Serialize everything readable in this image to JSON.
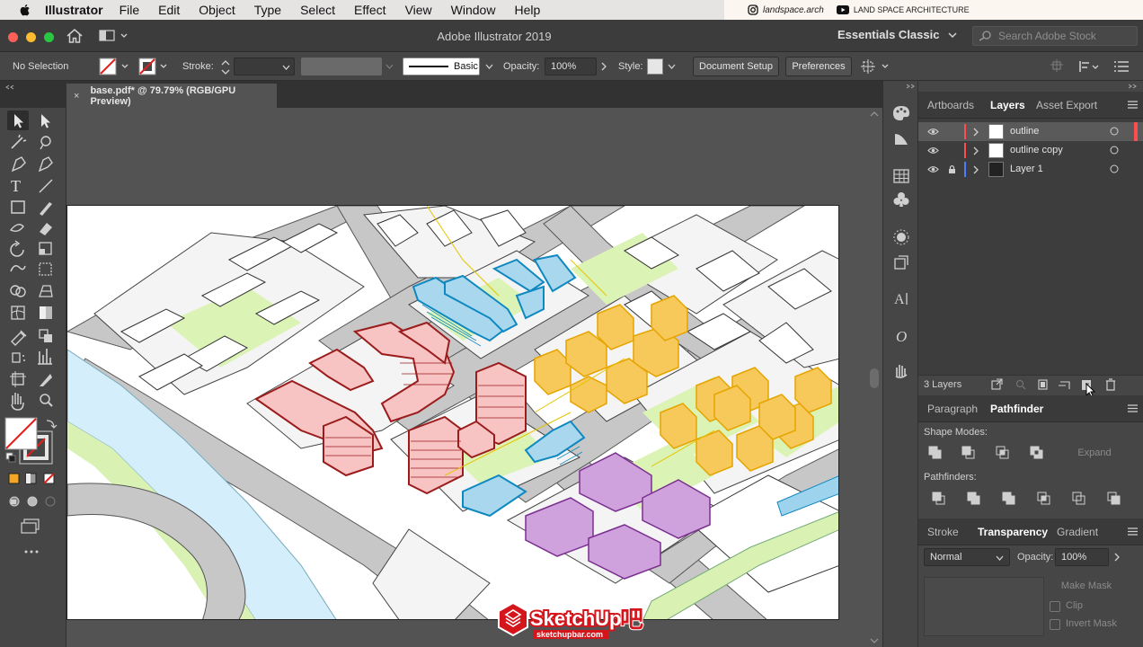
{
  "menubar": {
    "app": "Illustrator",
    "items": [
      "File",
      "Edit",
      "Object",
      "Type",
      "Select",
      "Effect",
      "View",
      "Window",
      "Help"
    ],
    "instagram": "landspace.arch",
    "youtube": "LAND SPACE ARCHITECTURE"
  },
  "appbar": {
    "title": "Adobe Illustrator 2019",
    "workspace": "Essentials Classic",
    "search_placeholder": "Search Adobe Stock"
  },
  "control": {
    "selection": "No Selection",
    "stroke_label": "Stroke:",
    "brush": "Basic",
    "opacity_label": "Opacity:",
    "opacity_value": "100%",
    "style_label": "Style:",
    "document_setup": "Document Setup",
    "preferences": "Preferences"
  },
  "document": {
    "tab_title": "base.pdf* @ 79.79% (RGB/GPU Preview)",
    "close": "×"
  },
  "layers_panel": {
    "tabs": [
      "Artboards",
      "Layers",
      "Asset Export"
    ],
    "active_tab": "Layers",
    "layers": [
      {
        "name": "outline",
        "color": "#ff4d4d"
      },
      {
        "name": "outline copy",
        "color": "#ff4d4d"
      },
      {
        "name": "Layer 1",
        "color": "#4d7dff"
      }
    ],
    "count": "3 Layers"
  },
  "pathfinder_panel": {
    "tabs": [
      "Paragraph",
      "Pathfinder"
    ],
    "active_tab": "Pathfinder",
    "shape_modes": "Shape Modes:",
    "expand": "Expand",
    "pathfinders": "Pathfinders:"
  },
  "transparency_panel": {
    "tabs": [
      "Stroke",
      "Transparency",
      "Gradient"
    ],
    "active_tab": "Transparency",
    "blend_mode": "Normal",
    "opacity_label": "Opacity:",
    "opacity_value": "100%",
    "make_mask": "Make Mask",
    "clip": "Clip",
    "invert_mask": "Invert Mask"
  },
  "watermark": {
    "name": "SketchUp吧",
    "url": "sketchupbar.com"
  }
}
